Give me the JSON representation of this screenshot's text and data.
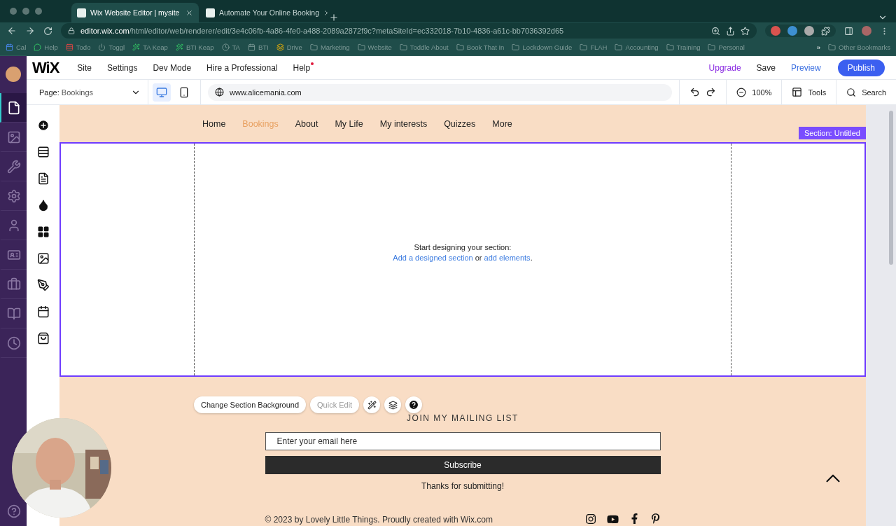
{
  "browser": {
    "tabs": [
      {
        "title": "Wix Website Editor | mysite",
        "selected": true
      },
      {
        "title": "Automate Your Online Booking",
        "selected": false
      }
    ],
    "url_host": "editor.wix.com",
    "url_path": "/html/editor/web/renderer/edit/3e4c06fb-4a86-4fe0-a488-2089a2872f9c?metaSiteId=ec332018-7b10-4836-a61c-bb7036392d65",
    "bookmarks": [
      {
        "label": "Cal",
        "kind": "calendar"
      },
      {
        "label": "Help",
        "kind": "chat"
      },
      {
        "label": "Todo",
        "kind": "todo"
      },
      {
        "label": "Toggl",
        "kind": "power"
      },
      {
        "label": "TA Keap",
        "kind": "keap"
      },
      {
        "label": "BTI Keap",
        "kind": "keap"
      },
      {
        "label": "TA",
        "kind": "circle"
      },
      {
        "label": "BTI",
        "kind": "app"
      },
      {
        "label": "Drive",
        "kind": "drive"
      },
      {
        "label": "Marketing",
        "kind": "folder"
      },
      {
        "label": "Website",
        "kind": "folder"
      },
      {
        "label": "Toddle About",
        "kind": "folder"
      },
      {
        "label": "Book That In",
        "kind": "folder"
      },
      {
        "label": "Lockdown Guide",
        "kind": "folder"
      },
      {
        "label": "FLAH",
        "kind": "folder"
      },
      {
        "label": "Accounting",
        "kind": "folder"
      },
      {
        "label": "Training",
        "kind": "folder"
      },
      {
        "label": "Personal",
        "kind": "folder"
      }
    ],
    "more_bookmarks": "»",
    "other_bookmarks": "Other Bookmarks"
  },
  "editor": {
    "logo": "WiX",
    "menu": [
      {
        "label": "Site",
        "dot": false
      },
      {
        "label": "Settings",
        "dot": false
      },
      {
        "label": "Dev Mode",
        "dot": false
      },
      {
        "label": "Hire a Professional",
        "dot": false
      },
      {
        "label": "Help",
        "dot": true
      }
    ],
    "upgrade": "Upgrade",
    "save": "Save",
    "preview": "Preview",
    "publish": "Publish",
    "page_label": "Page:",
    "page_value": "Bookings",
    "devices": [
      {
        "kind": "desktop",
        "selected": true
      },
      {
        "kind": "mobile",
        "selected": false
      }
    ],
    "domain": "www.alicemania.com",
    "zoom": "100%",
    "tools": "Tools",
    "search": "Search",
    "side_panels": [
      {
        "kind": "page",
        "selected": true
      },
      {
        "kind": "media",
        "selected": false
      },
      {
        "kind": "wrench",
        "selected": false
      },
      {
        "kind": "gear",
        "selected": false
      },
      {
        "kind": "person",
        "selected": false
      },
      {
        "kind": "card",
        "selected": false
      },
      {
        "kind": "briefcase",
        "selected": false
      },
      {
        "kind": "book",
        "selected": false
      },
      {
        "kind": "clock",
        "selected": false
      }
    ],
    "tools_panel": [
      {
        "kind": "add"
      },
      {
        "kind": "sections"
      },
      {
        "kind": "pages"
      },
      {
        "kind": "theme"
      },
      {
        "kind": "apps"
      },
      {
        "kind": "media"
      },
      {
        "kind": "pen"
      },
      {
        "kind": "calendar"
      },
      {
        "kind": "store"
      }
    ]
  },
  "site": {
    "nav": [
      {
        "label": "Home",
        "selected": false
      },
      {
        "label": "Bookings",
        "selected": true
      },
      {
        "label": "About",
        "selected": false
      },
      {
        "label": "My Life",
        "selected": false
      },
      {
        "label": "My interests",
        "selected": false
      },
      {
        "label": "Quizzes",
        "selected": false
      },
      {
        "label": "More",
        "selected": false
      }
    ],
    "section_label": "Section: Untitled",
    "empty_title": "Start designing your section:",
    "empty_link_1": "Add a designed section",
    "empty_or": "or",
    "empty_link_2": "add elements",
    "empty_end": ".",
    "section_toolbar": {
      "background": "Change Section Background",
      "quick_edit": "Quick Edit",
      "quick_edit_disabled": true
    },
    "mailing_title": "JOIN MY MAILING LIST",
    "email_placeholder": "Enter your email here",
    "subscribe": "Subscribe",
    "thanks": "Thanks for submitting!",
    "copyright": "© 2023 by Lovely Little Things. Proudly created with Wix.com"
  }
}
